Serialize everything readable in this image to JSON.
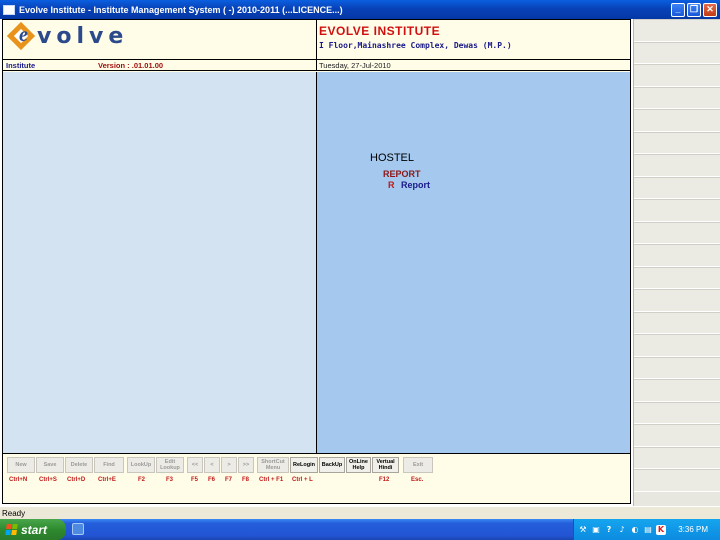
{
  "window": {
    "title": "Evolve Institute - Institute Management System ( -) 2010-2011 (...LICENCE...)",
    "controls": [
      "minimize-icon",
      "restore-icon",
      "close-icon"
    ]
  },
  "header": {
    "logo_text": "volve",
    "logo_letter": "e",
    "institute_name": "EVOLVE INSTITUTE",
    "institute_address": "I Floor,Mainashree Complex, Dewas (M.P.)"
  },
  "infobar": {
    "module": "Institute",
    "version": "Version : .01.01.00",
    "date": "Tuesday, 27-Jul-2010"
  },
  "menu": {
    "heading": "HOSTEL",
    "subheading": "REPORT",
    "item_key": "R",
    "item_label": "Report"
  },
  "toolbar": {
    "buttons": [
      {
        "label": "New",
        "key": "Ctrl+N"
      },
      {
        "label": "Save",
        "key": "Ctrl+S"
      },
      {
        "label": "Delete",
        "key": "Ctrl+D"
      },
      {
        "label": "Find",
        "key": "Ctrl+E"
      },
      {
        "label": "LookUp",
        "key": "F2"
      },
      {
        "label": "Edit Lookup",
        "key": "F3"
      },
      {
        "label": "<<",
        "key": "F5"
      },
      {
        "label": "<",
        "key": "F6"
      },
      {
        "label": ">",
        "key": "F7"
      },
      {
        "label": ">>",
        "key": "F8"
      },
      {
        "label": "ShortCut Menu",
        "key": "Ctrl + F1"
      },
      {
        "label": "ReLogin",
        "key": "Ctrl + L"
      },
      {
        "label": "BackUp",
        "key": ""
      },
      {
        "label": "OnLine Help",
        "key": ""
      },
      {
        "label": "Vertual Hindi",
        "key": "F12"
      },
      {
        "label": "Exit",
        "key": "Esc."
      }
    ]
  },
  "statusbar": {
    "text": "Ready"
  },
  "taskbar": {
    "start_label": "start",
    "clock": "3:36 PM",
    "colors": {
      "start": "#2e8a2e",
      "taskbar": "#245edb",
      "tray": "#0c8be0"
    }
  }
}
